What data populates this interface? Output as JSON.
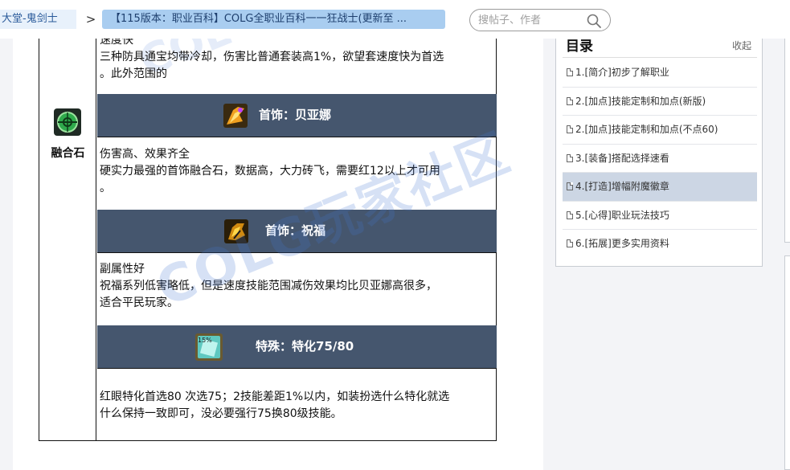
{
  "breadcrumb": {
    "home": "大堂-鬼剑士",
    "separator": ">",
    "current": "【115版本：职业百科】COLG全职业百科一一狂战士(更新至 ..."
  },
  "search": {
    "placeholder": "搜帖子、作者",
    "icon": "search-icon"
  },
  "content": {
    "top_text": "速度快\n三种防具通宝均带冷却，伤害比普通套装高1%，欲望套速度快为首选\n。此外范围的",
    "category_label": "融合石",
    "category_icon": "gem-icon",
    "rows": [
      {
        "header": "首饰：贝亚娜",
        "icon": "necklace-icon",
        "text": "伤害高、效果齐全\n硬实力最强的首饰融合石，数据高，大力砖飞，需要红12以上才可用\n。"
      },
      {
        "header": "首饰：祝福",
        "icon": "blessing-icon",
        "text": "副属性好\n祝福系列低害略低，但是速度技能范围减伤效果均比贝亚娜高很多，\n适合平民玩家。"
      },
      {
        "header": "特殊：特化75/80",
        "icon": "special-card-icon",
        "icon_text": "15%",
        "text": "红眼特化首选80 次选75；2技能差距1%以内，如装扮选什么特化就选\n什么保持一致即可，没必要强行75换80级技能。"
      }
    ]
  },
  "watermark": {
    "main": "COLG玩家社区",
    "secondary": "COLG"
  },
  "toc": {
    "title": "目录",
    "collapse": "收起",
    "items": [
      {
        "label": "1.[简介]初步了解职业",
        "active": false
      },
      {
        "label": "2.[加点]技能定制和加点(新版)",
        "active": false
      },
      {
        "label": "2.[加点]技能定制和加点(不点60)",
        "active": false
      },
      {
        "label": "3.[装备]搭配选择速看",
        "active": false
      },
      {
        "label": "4.[打造]增幅附魔徽章",
        "active": true
      },
      {
        "label": "5.[心得]职业玩法技巧",
        "active": false
      },
      {
        "label": "6.[拓展]更多实用资料",
        "active": false
      }
    ]
  },
  "colors": {
    "header_row": "#45566e",
    "toc_active": "#ccd6e4",
    "crumb_title_bg": "#a9cdf0",
    "watermark": "#4678d2"
  }
}
